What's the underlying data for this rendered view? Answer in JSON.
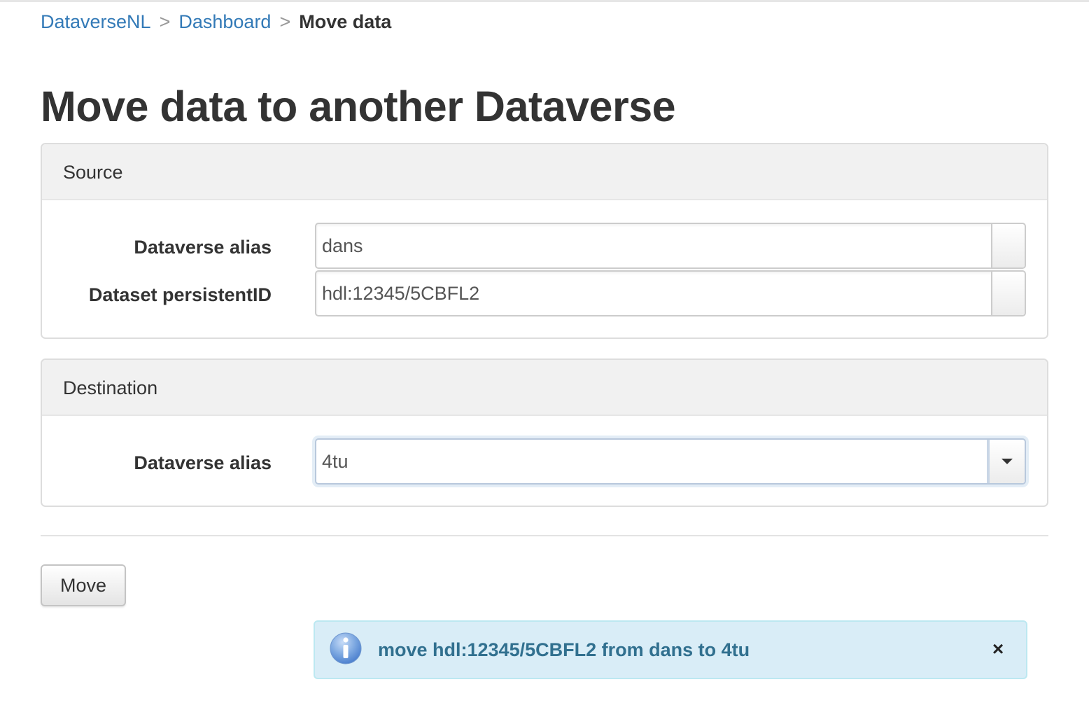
{
  "breadcrumb": {
    "items": [
      {
        "label": "DataverseNL"
      },
      {
        "label": "Dashboard"
      }
    ],
    "separator": ">",
    "current": "Move data"
  },
  "page": {
    "title": "Move data to another Dataverse"
  },
  "source": {
    "heading": "Source",
    "alias_label": "Dataverse alias",
    "alias_value": "dans",
    "pid_label": "Dataset persistentID",
    "pid_value": "hdl:12345/5CBFL2"
  },
  "destination": {
    "heading": "Destination",
    "alias_label": "Dataverse alias",
    "alias_value": "4tu"
  },
  "actions": {
    "move_label": "Move"
  },
  "message": {
    "text": "move hdl:12345/5CBFL2 from dans to 4tu",
    "close_glyph": "×",
    "icon": "info-icon"
  },
  "colors": {
    "link": "#337ab7",
    "info_bg": "#d9edf7",
    "info_text": "#31708f",
    "info_border": "#bce8f1"
  }
}
